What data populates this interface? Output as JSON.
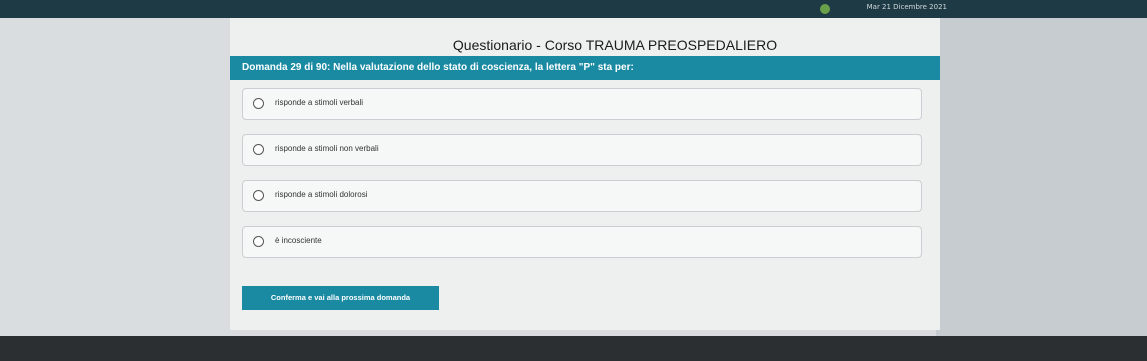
{
  "header": {
    "title": "Questionario - Corso TRAUMA PREOSPEDALIERO",
    "date": "Mar 21 Dicembre 2021"
  },
  "question": {
    "text": "Domanda 29 di 90: Nella valutazione dello stato di coscienza, la lettera \"P\" sta per:"
  },
  "options": [
    {
      "label": "risponde a stimoli verbali"
    },
    {
      "label": "risponde a stimoli non verbali"
    },
    {
      "label": "risponde a stimoli dolorosi"
    },
    {
      "label": "è incosciente"
    }
  ],
  "confirm_button": {
    "label": "Conferma e vai alla prossima domanda"
  },
  "colors": {
    "accent": "#1a8aa3",
    "topbar": "#1e3a44"
  }
}
